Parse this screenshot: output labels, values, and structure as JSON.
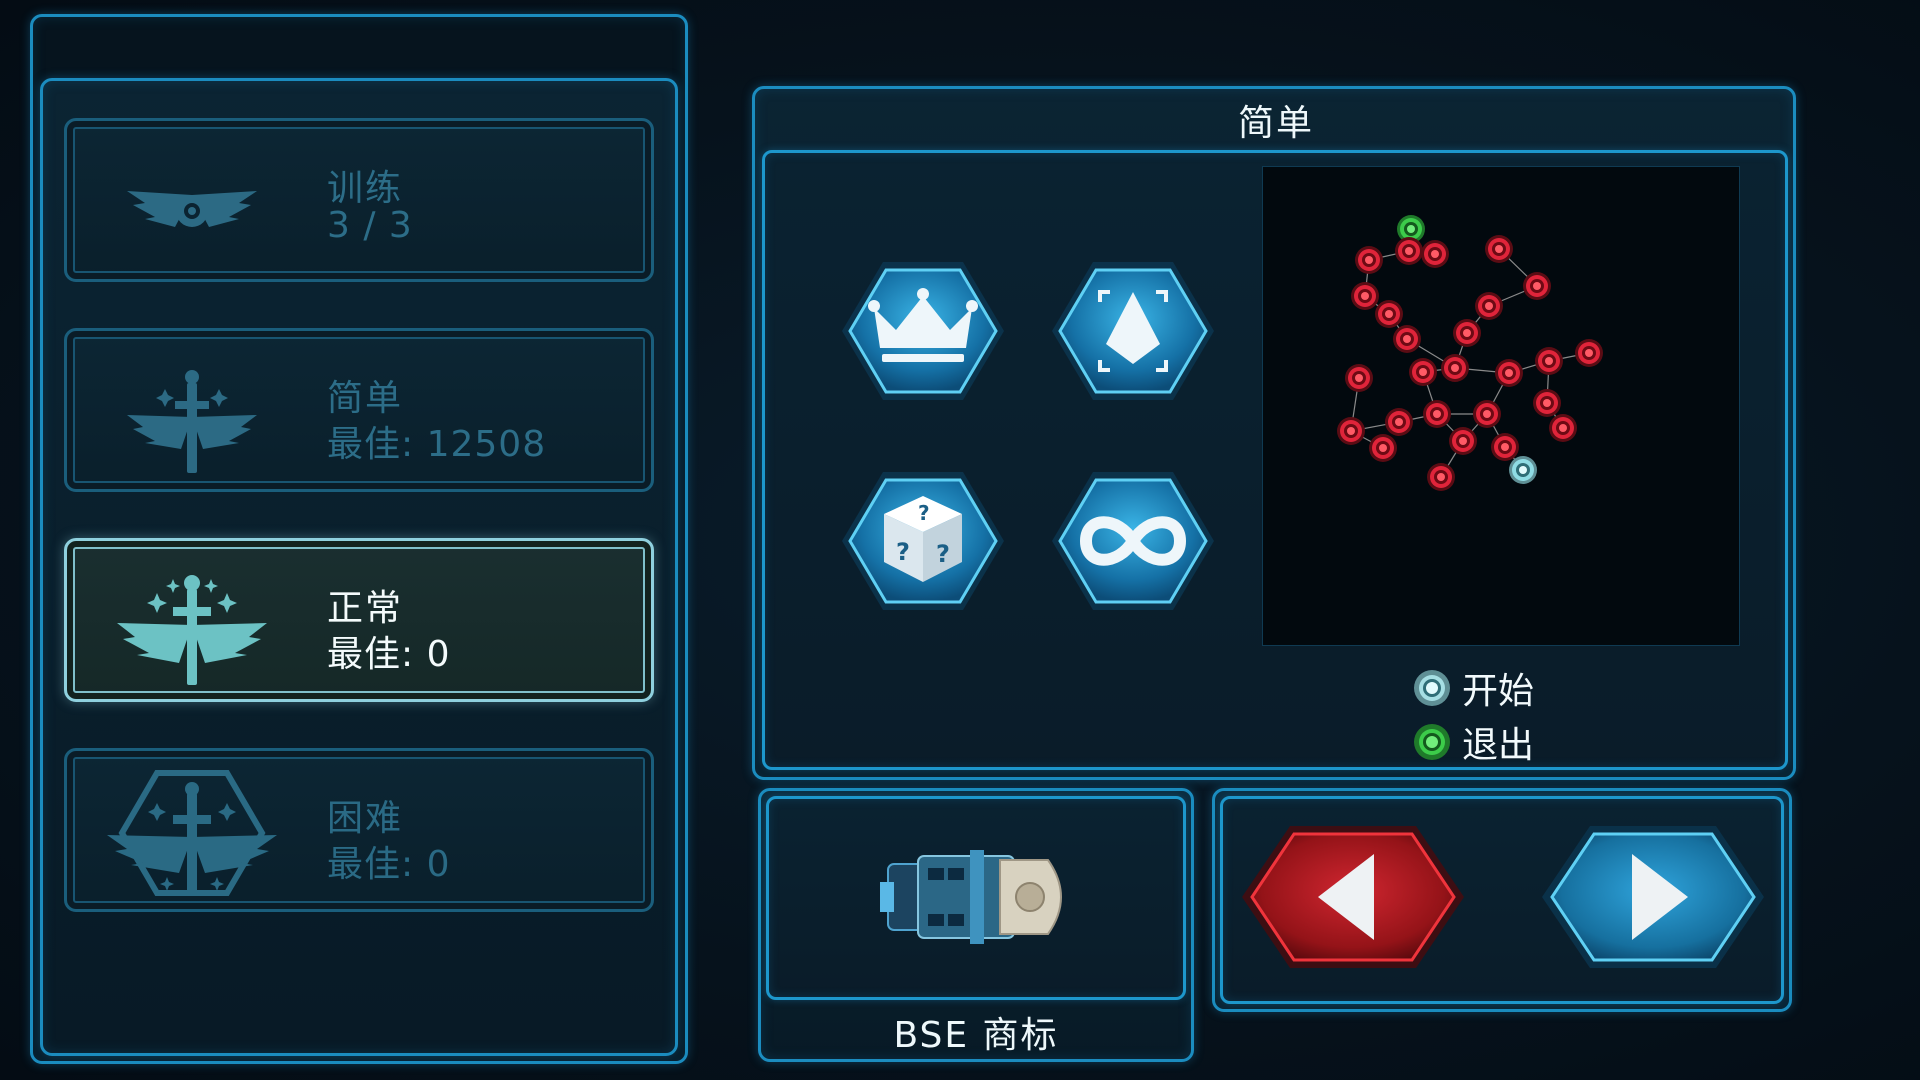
{
  "modes": [
    {
      "title": "训练",
      "sub": "3 / 3",
      "emblem": "wings-badge-icon",
      "state": "dim"
    },
    {
      "title": "简单",
      "sub": "最佳: 12508",
      "emblem": "sword-wings-icon",
      "state": "dim"
    },
    {
      "title": "正常",
      "sub": "最佳: 0",
      "emblem": "sword-wings-stars-icon",
      "state": "selected"
    },
    {
      "title": "困难",
      "sub": "最佳: 0",
      "emblem": "hex-sword-wings-icon",
      "state": "dim"
    }
  ],
  "detail": {
    "title": "简单",
    "modifiers": [
      "crown-icon",
      "diamond-target-icon",
      "mystery-dice-icon",
      "infinity-icon"
    ],
    "legend": {
      "start": "开始",
      "exit": "退出"
    }
  },
  "ship": {
    "label": "BSE 商标",
    "icon": "spaceship-icon"
  },
  "nav": {
    "prev": "previous-arrow-icon",
    "next": "next-arrow-icon"
  },
  "colors": {
    "frame": "#1b8cbf",
    "node_red": "#e0243a",
    "node_start": "#8fdce4",
    "node_exit": "#3ccc4a",
    "prev_button": "#b31c22",
    "next_button": "#1a7fb0"
  }
}
